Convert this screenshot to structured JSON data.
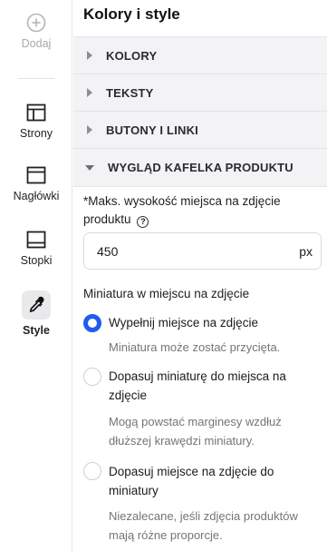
{
  "rail": {
    "add_label": "Dodaj",
    "items": [
      {
        "label": "Strony",
        "icon": "pages-icon"
      },
      {
        "label": "Nagłówki",
        "icon": "header-layout-icon"
      },
      {
        "label": "Stopki",
        "icon": "footer-layout-icon"
      },
      {
        "label": "Style",
        "icon": "eyedropper-icon",
        "active": true
      }
    ]
  },
  "panel": {
    "title": "Kolory i style",
    "sections": [
      {
        "title": "KOLORY",
        "expanded": false
      },
      {
        "title": "TEKSTY",
        "expanded": false
      },
      {
        "title": "BUTONY I LINKI",
        "expanded": false
      },
      {
        "title": "WYGLĄD KAFELKA PRODUKTU",
        "expanded": true
      }
    ],
    "max_height": {
      "label": "*Maks. wysokość miejsca na zdjęcie produktu",
      "help": "?",
      "value": "450",
      "unit": "px"
    },
    "thumbnail": {
      "label": "Miniatura w miejscu na zdjęcie",
      "options": [
        {
          "title": "Wypełnij miejsce na zdjęcie",
          "desc": "Miniatura może zostać przycięta.",
          "selected": true
        },
        {
          "title": "Dopasuj miniaturę do miejsca na zdjęcie",
          "desc": "Mogą powstać marginesy wzdłuż dłuższej krawędzi miniatury.",
          "selected": false
        },
        {
          "title": "Dopasuj miejsce na zdjęcie do miniatury",
          "desc": "Niezalecane, jeśli zdjęcia produktów mają różne proporcje.",
          "selected": false
        }
      ]
    }
  },
  "colors": {
    "accent": "#1f5cf0",
    "section_bg": "#f3f3f6",
    "muted": "#74747b"
  }
}
